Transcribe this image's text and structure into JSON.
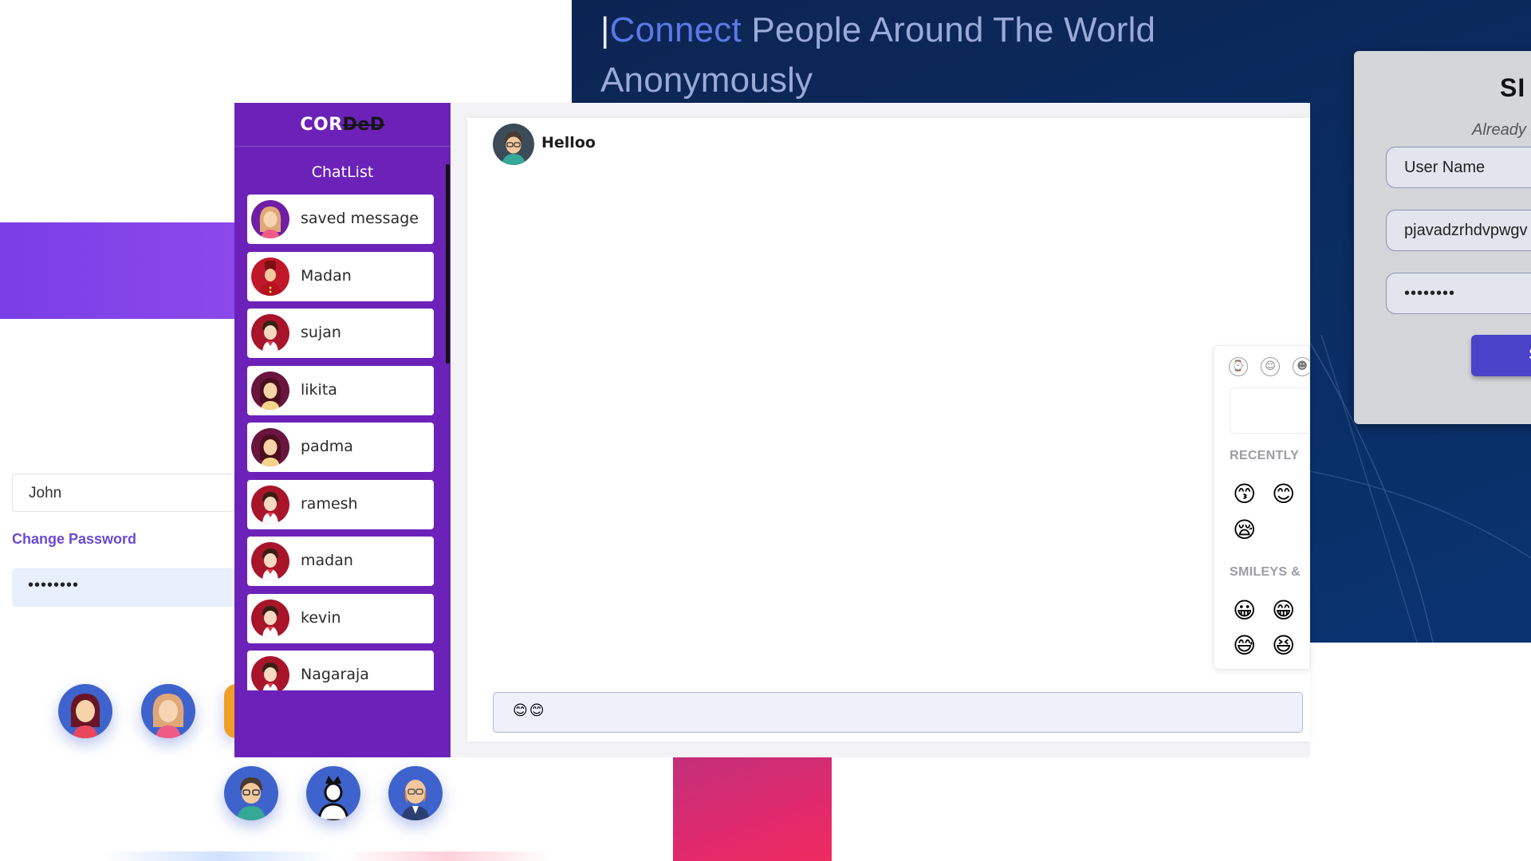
{
  "hero": {
    "cursor": "|",
    "title_highlight": "Connect",
    "title_rest": " People Around The World",
    "title_line2": "Anonymously"
  },
  "signin": {
    "title": "SI",
    "subtitle": "Already r",
    "username_placeholder": "User Name",
    "email_value": "pjavadzrhdvpwgv",
    "password_value": "••••••••",
    "button_label": "S"
  },
  "profile": {
    "name_value": "John",
    "change_password_label": "Change Password",
    "password_value": "••••••••",
    "avatars": [
      "girl-avatar",
      "blonde-girl-avatar",
      "partial-avatar",
      "glasses-man-avatar",
      "king-avatar",
      "bald-man-avatar"
    ]
  },
  "app": {
    "brand_visible": "COR",
    "brand_struck": "DeD",
    "chatlist_title": "ChatList",
    "contacts": [
      {
        "name": "saved message",
        "avatar": "blonde-girl-avatar"
      },
      {
        "name": "Madan",
        "avatar": "guard-avatar"
      },
      {
        "name": "sujan",
        "avatar": "boy-avatar"
      },
      {
        "name": "likita",
        "avatar": "girl-avatar"
      },
      {
        "name": "padma",
        "avatar": "girl-avatar"
      },
      {
        "name": "ramesh",
        "avatar": "boy-avatar"
      },
      {
        "name": "madan",
        "avatar": "boy-avatar"
      },
      {
        "name": "kevin",
        "avatar": "boy-avatar"
      },
      {
        "name": "Nagaraja",
        "avatar": "boy-avatar"
      }
    ]
  },
  "chat": {
    "contact_name": "Helloo",
    "input_value": "😊😊"
  },
  "emoji_picker": {
    "tabs": [
      "recent-icon",
      "smileys-icon",
      "people-icon"
    ],
    "categories": [
      "RECENTLY",
      "SMILEYS &"
    ],
    "recent": [
      "😙",
      "😊",
      "😪"
    ],
    "smileys": [
      "😀",
      "😁",
      "😅",
      "😆"
    ]
  },
  "colors": {
    "sidebar": "#6c22b8",
    "brand_band": "#7a3ee6",
    "signin_bg": "#0a2d62",
    "accent_blue": "#5c77e8",
    "send_button": "#4a42c9"
  }
}
